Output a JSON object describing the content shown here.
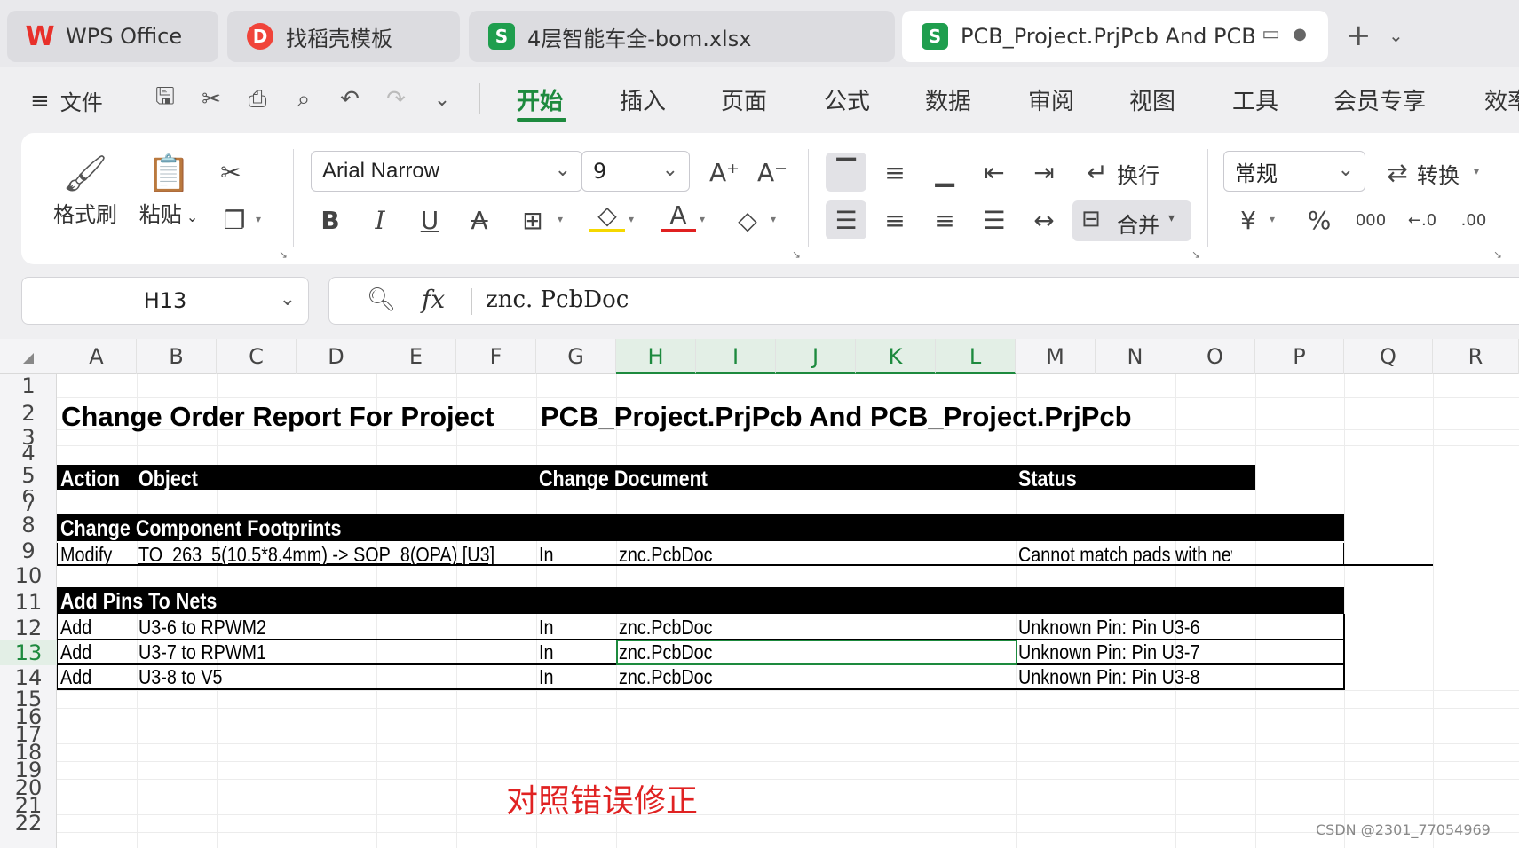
{
  "tabs": [
    {
      "label": "WPS Office",
      "icon": "wps-logo-icon"
    },
    {
      "label": "找稻壳模板",
      "icon": "docer-icon"
    },
    {
      "label": "4层智能车全-bom.xlsx",
      "icon": "spreadsheet-icon"
    },
    {
      "label": "PCB_Project.PrjPcb And PCB",
      "icon": "spreadsheet-icon"
    }
  ],
  "menu": {
    "file_label": "文件",
    "tabs": [
      "开始",
      "插入",
      "页面",
      "公式",
      "数据",
      "审阅",
      "视图",
      "工具",
      "会员专享",
      "效率"
    ]
  },
  "ribbon": {
    "format_painter": "格式刷",
    "paste": "粘贴",
    "font_name": "Arial Narrow",
    "font_size": "9",
    "wrap": "换行",
    "merge": "合并",
    "number_format": "常规",
    "convert": "转换"
  },
  "formula_bar": {
    "name_box": "H13",
    "fx": "fx",
    "value": "znc. PcbDoc"
  },
  "columns": [
    "A",
    "B",
    "C",
    "D",
    "E",
    "F",
    "G",
    "H",
    "I",
    "J",
    "K",
    "L",
    "M",
    "N",
    "O",
    "P",
    "Q",
    "R"
  ],
  "rows": [
    "1",
    "2",
    "3",
    "4",
    "5",
    "6",
    "7",
    "8",
    "9",
    "10",
    "11",
    "12",
    "13",
    "14",
    "15",
    "16",
    "17",
    "18",
    "19",
    "20",
    "21",
    "22"
  ],
  "sheet": {
    "title_left": "Change Order Report For Project",
    "title_right": "PCB_Project.PrjPcb And PCB_Project.PrjPcb",
    "header": {
      "action": "Action",
      "object": "Object",
      "doc": "Change Document",
      "status": "Status"
    },
    "section1": "Change Component Footprints",
    "row9": {
      "action": "Modify",
      "object": "TO_263_5(10.5*8.4mm) -> SOP_8(OPA) [U3]",
      "in": "In",
      "doc": "znc.PcbDoc",
      "status": "Cannot match pads with new fo"
    },
    "section2": "Add Pins To Nets",
    "rows": [
      {
        "action": "Add",
        "object": "U3-6 to RPWM2",
        "in": "In",
        "doc": "znc.PcbDoc",
        "status": "Unknown Pin: Pin U3-6"
      },
      {
        "action": "Add",
        "object": "U3-7 to RPWM1",
        "in": "In",
        "doc": "znc.PcbDoc",
        "status": "Unknown Pin: Pin U3-7"
      },
      {
        "action": "Add",
        "object": "U3-8 to V5",
        "in": "In",
        "doc": "znc.PcbDoc",
        "status": "Unknown Pin: Pin U3-8"
      }
    ]
  },
  "annotation": "对照错误修正",
  "watermark": "CSDN @2301_77054969",
  "colors": {
    "accent": "#1d8a3e",
    "annotation": "#e02222",
    "wps_red": "#e8302a",
    "sheet_green": "#1f9e4e"
  }
}
